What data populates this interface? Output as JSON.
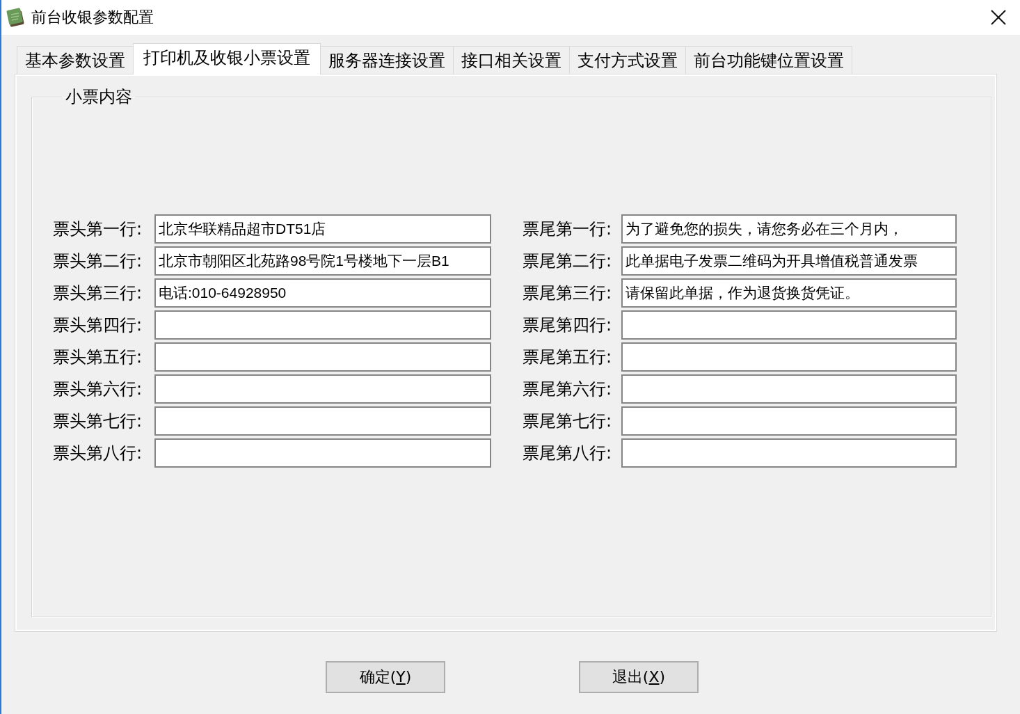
{
  "window": {
    "title": "前台收银参数配置"
  },
  "tabs": [
    {
      "label": "基本参数设置",
      "selected": false
    },
    {
      "label": "打印机及收银小票设置",
      "selected": true
    },
    {
      "label": "服务器连接设置",
      "selected": false
    },
    {
      "label": "接口相关设置",
      "selected": false
    },
    {
      "label": "支付方式设置",
      "selected": false
    },
    {
      "label": "前台功能键位置设置",
      "selected": false
    }
  ],
  "receipt_content": {
    "title": "小票内容",
    "header_lines": [
      {
        "label": "票头第一行:",
        "value": "北京华联精品超市DT51店"
      },
      {
        "label": "票头第二行:",
        "value": "北京市朝阳区北苑路98号院1号楼地下一层B1"
      },
      {
        "label": "票头第三行:",
        "value": "电话:010-64928950"
      },
      {
        "label": "票头第四行:"
      },
      {
        "label": "票头第五行:"
      },
      {
        "label": "票头第六行:"
      },
      {
        "label": "票头第七行:"
      },
      {
        "label": "票头第八行:"
      }
    ],
    "footer_lines": [
      {
        "label": "票尾第一行:",
        "value": "为了避免您的损失，请您务必在三个月内，"
      },
      {
        "label": "票尾第二行:",
        "value": "此单据电子发票二维码为开具增值税普通发票"
      },
      {
        "label": "票尾第三行:",
        "value": "请保留此单据，作为退货换货凭证。"
      },
      {
        "label": "票尾第四行:"
      },
      {
        "label": "票尾第五行:"
      },
      {
        "label": "票尾第六行:"
      },
      {
        "label": "票尾第七行:"
      },
      {
        "label": "票尾第八行:"
      }
    ]
  },
  "buttons": [
    {
      "label_start": "确定(",
      "mnemonic": "Y",
      "label_end": ")"
    },
    {
      "label_start": "退出(",
      "mnemonic": "X",
      "label_end": ")"
    }
  ]
}
